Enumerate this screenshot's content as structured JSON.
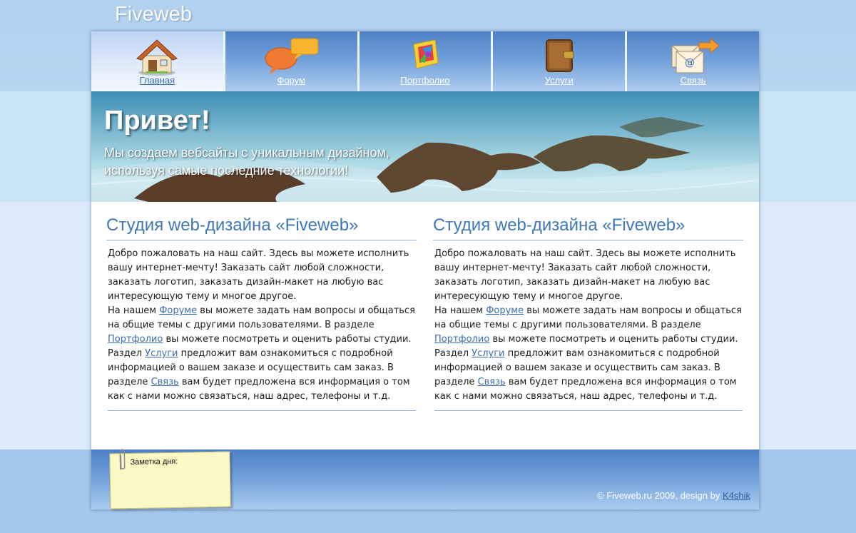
{
  "site": {
    "logo": "Fiveweb"
  },
  "nav": {
    "items": [
      {
        "label": "Главная",
        "icon": "home-icon",
        "active": true
      },
      {
        "label": "Форум",
        "icon": "chat-bubbles-icon"
      },
      {
        "label": "Портфолио",
        "icon": "palette-icon"
      },
      {
        "label": "Услуги",
        "icon": "wallet-icon"
      },
      {
        "label": "Связь",
        "icon": "mail-icon"
      }
    ]
  },
  "banner": {
    "title": "Привет!",
    "subtitle": "Мы создаем вебсайты с уникальным дизайном, используя самые последние технологии!"
  },
  "columns": [
    {
      "title": "Студия web-дизайна «Fiveweb»",
      "p1": "Добро пожаловать на наш сайт. Здесь вы можете исполнить вашу интернет-мечту! Заказать сайт любой сложности, заказать логотип, заказать дизайн-макет на любую вас интересующую тему и многое другое.",
      "p2_a": "На нашем ",
      "link_forum": "Форуме",
      "p2_b": " вы можете задать нам вопросы и общаться на общие темы с другими пользователями. В разделе ",
      "link_portfolio": "Портфолио",
      "p2_c": " вы можете посмотреть и оценить работы студии. Раздел ",
      "link_services": "Услуги",
      "p2_d": " предложит вам ознакомиться с подробной информацией о вашем заказе и осуществить сам заказ. В разделе ",
      "link_contact": "Связь",
      "p2_e": " вам будет предложена вся информация о том как с нами можно связаться, наш адрес, телефоны и т.д."
    },
    {
      "title": "Студия web-дизайна «Fiveweb»",
      "p1": "Добро пожаловать на наш сайт. Здесь вы можете исполнить вашу интернет-мечту! Заказать сайт любой сложности, заказать логотип, заказать дизайн-макет на любую вас интересующую тему и многое другое.",
      "p2_a": "На нашем ",
      "link_forum": "Форуме",
      "p2_b": " вы можете задать нам вопросы и общаться на общие темы с другими пользователями. В разделе ",
      "link_portfolio": "Портфолио",
      "p2_c": " вы можете посмотреть и оценить работы студии. Раздел ",
      "link_services": "Услуги",
      "p2_d": " предложит вам ознакомиться с подробной информацией о вашем заказе и осуществить сам заказ. В разделе ",
      "link_contact": "Связь",
      "p2_e": " вам будет предложена вся информация о том как с нами можно связаться, наш адрес, телефоны и т.д."
    }
  ],
  "footer": {
    "note_label": "Заметка дня:",
    "copyright": "© Fiveweb.ru 2009, design by ",
    "designer": "K4shik"
  },
  "colors": {
    "accent": "#3f78b7",
    "nav": "#5d90d2",
    "note": "#fdf9c7"
  }
}
